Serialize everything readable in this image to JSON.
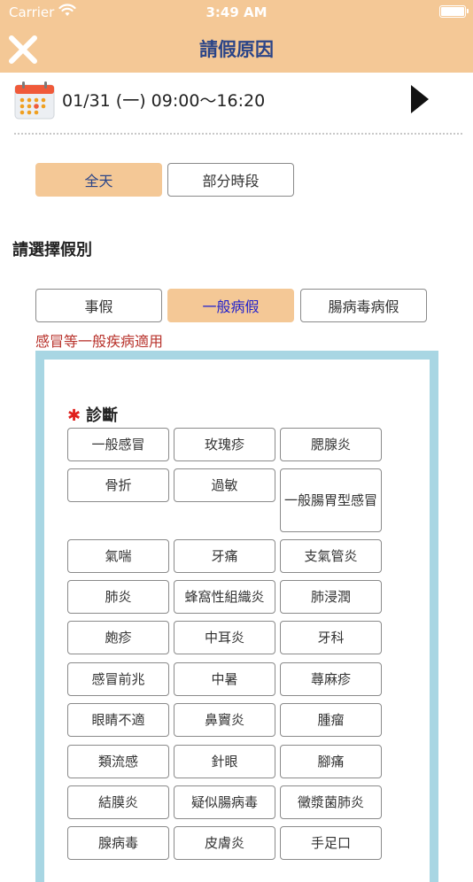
{
  "status": {
    "carrier": "Carrier",
    "time": "3:49 AM"
  },
  "header": {
    "title": "請假原因"
  },
  "date": {
    "text": "01/31 (一) 09:00～16:20"
  },
  "duration": [
    {
      "label": "全天",
      "active": true
    },
    {
      "label": "部分時段",
      "active": false
    }
  ],
  "leave_section": {
    "label": "請選擇假別"
  },
  "leave_types": [
    {
      "label": "事假",
      "active": false
    },
    {
      "label": "一般病假",
      "active": true
    },
    {
      "label": "腸病毒病假",
      "active": false
    }
  ],
  "note": "感冒等一般疾病適用",
  "diagnosis": {
    "star": "✱",
    "label": "診斷",
    "options": [
      "一般感冒",
      "玫瑰疹",
      "腮腺炎",
      "骨折",
      "過敏",
      "一般腸胃型感冒",
      "氣喘",
      "牙痛",
      "支氣管炎",
      "肺炎",
      "蜂窩性組織炎",
      "肺浸潤",
      "皰疹",
      "中耳炎",
      "牙科",
      "感冒前兆",
      "中暑",
      "蕁麻疹",
      "眼睛不適",
      "鼻竇炎",
      "腫瘤",
      "類流感",
      "針眼",
      "腳痛",
      "結膜炎",
      "疑似腸病毒",
      "黴漿菌肺炎",
      "腺病毒",
      "皮膚炎",
      "手足口"
    ]
  },
  "colors": {
    "header_bg": "#f4c896",
    "title": "#2a4488",
    "note": "#b8322b",
    "panel_border": "#a8d6e3"
  }
}
